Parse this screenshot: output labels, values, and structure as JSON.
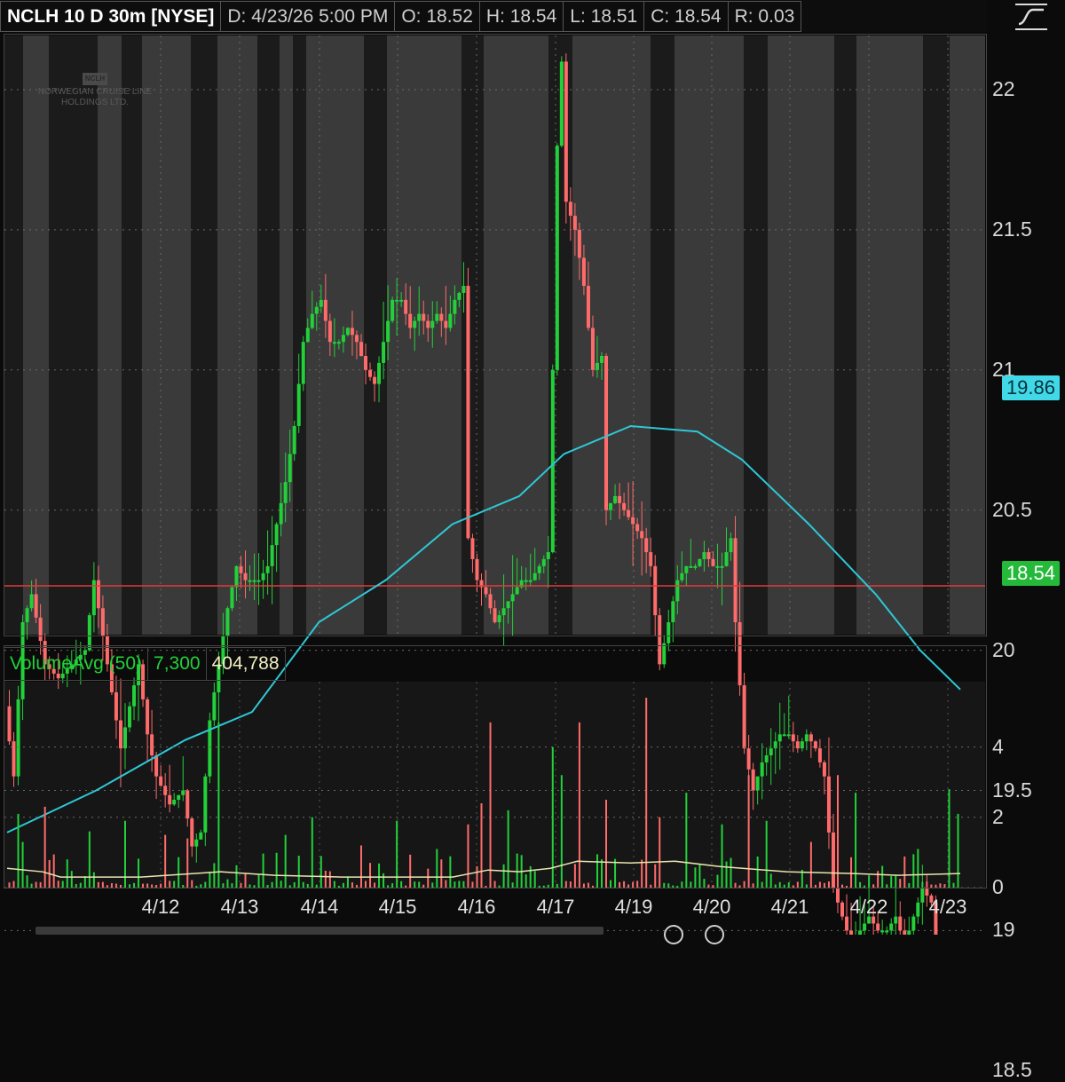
{
  "header": {
    "symbol": "NCLH 10 D 30m [NYSE]",
    "date": "D: 4/23/26 5:00 PM",
    "open": "O: 18.52",
    "high": "H: 18.54",
    "low": "L: 18.51",
    "close": "C: 18.54",
    "range": "R: 0.03"
  },
  "watermark": {
    "logo": "NCLH",
    "line1": "NORWEGIAN CRUISE LINE",
    "line2": "HOLDINGS LTD."
  },
  "badges": {
    "ma_value": "19.86",
    "last_price": "18.54"
  },
  "volume_legend": {
    "name": "VolumeAvg (50)",
    "volume": "7,300",
    "avg": "404,788"
  },
  "colors": {
    "up": "#22d13a",
    "down": "#ff6b6b",
    "ma": "#2ec8d6",
    "ref_line": "#e43a3a",
    "vol_avg": "#e8e6b0",
    "session_dark": "#1b1b1b",
    "session_light": "#3a3a3a"
  },
  "chart_data": [
    {
      "type": "candlestick",
      "interval": "30m",
      "period": "10 D",
      "ylim": [
        18.2,
        22.4
      ],
      "yticks": [
        "22",
        "21.5",
        "21",
        "20.5",
        "20",
        "19.5",
        "19",
        "18.5"
      ],
      "xticks": [
        "4/12",
        "4/13",
        "4/14",
        "4/15",
        "4/16",
        "4/17",
        "4/19",
        "4/20",
        "4/21",
        "4/22",
        "4/23"
      ],
      "reference_line": 20.23,
      "moving_average_last": 19.86,
      "last_price": 18.54,
      "price_path": [
        [
          0,
          19.8
        ],
        [
          2,
          19.55
        ],
        [
          4,
          20.1
        ],
        [
          6,
          20.2
        ],
        [
          9,
          19.95
        ],
        [
          12,
          19.9
        ],
        [
          15,
          19.95
        ],
        [
          18,
          20.0
        ],
        [
          20,
          20.25
        ],
        [
          23,
          19.95
        ],
        [
          26,
          19.65
        ],
        [
          28,
          19.8
        ],
        [
          30,
          19.95
        ],
        [
          32,
          19.7
        ],
        [
          34,
          19.55
        ],
        [
          37,
          19.45
        ],
        [
          40,
          19.5
        ],
        [
          42,
          19.3
        ],
        [
          44,
          19.35
        ],
        [
          46,
          19.75
        ],
        [
          48,
          19.95
        ],
        [
          50,
          20.15
        ],
        [
          52,
          20.3
        ],
        [
          54,
          20.25
        ],
        [
          57,
          20.25
        ],
        [
          59,
          20.3
        ],
        [
          61,
          20.45
        ],
        [
          63,
          20.6
        ],
        [
          65,
          20.8
        ],
        [
          67,
          21.1
        ],
        [
          69,
          21.2
        ],
        [
          71,
          21.25
        ],
        [
          73,
          21.1
        ],
        [
          75,
          21.1
        ],
        [
          77,
          21.15
        ],
        [
          79,
          21.1
        ],
        [
          81,
          21.0
        ],
        [
          83,
          20.95
        ],
        [
          85,
          21.1
        ],
        [
          87,
          21.25
        ],
        [
          89,
          21.25
        ],
        [
          91,
          21.15
        ],
        [
          93,
          21.2
        ],
        [
          95,
          21.15
        ],
        [
          97,
          21.2
        ],
        [
          99,
          21.15
        ],
        [
          101,
          21.25
        ],
        [
          103,
          21.3
        ],
        [
          104,
          20.4
        ],
        [
          106,
          20.25
        ],
        [
          108,
          20.2
        ],
        [
          110,
          20.1
        ],
        [
          112,
          20.15
        ],
        [
          114,
          20.2
        ],
        [
          116,
          20.25
        ],
        [
          118,
          20.25
        ],
        [
          120,
          20.3
        ],
        [
          122,
          20.35
        ],
        [
          123,
          21.0
        ],
        [
          124,
          21.8
        ],
        [
          125,
          22.1
        ],
        [
          126,
          21.6
        ],
        [
          128,
          21.5
        ],
        [
          130,
          21.3
        ],
        [
          132,
          21.0
        ],
        [
          134,
          21.05
        ],
        [
          135,
          20.5
        ],
        [
          137,
          20.55
        ],
        [
          139,
          20.5
        ],
        [
          141,
          20.45
        ],
        [
          143,
          20.4
        ],
        [
          145,
          20.3
        ],
        [
          147,
          19.95
        ],
        [
          149,
          20.1
        ],
        [
          151,
          20.25
        ],
        [
          153,
          20.3
        ],
        [
          155,
          20.3
        ],
        [
          157,
          20.35
        ],
        [
          159,
          20.3
        ],
        [
          161,
          20.3
        ],
        [
          163,
          20.4
        ],
        [
          164,
          20.1
        ],
        [
          166,
          19.65
        ],
        [
          168,
          19.5
        ],
        [
          170,
          19.6
        ],
        [
          172,
          19.65
        ],
        [
          174,
          19.7
        ],
        [
          176,
          19.7
        ],
        [
          178,
          19.65
        ],
        [
          180,
          19.7
        ],
        [
          182,
          19.65
        ],
        [
          184,
          19.55
        ],
        [
          186,
          19.15
        ],
        [
          188,
          19.05
        ],
        [
          190,
          18.95
        ],
        [
          192,
          19.0
        ],
        [
          194,
          19.05
        ],
        [
          196,
          19.0
        ],
        [
          198,
          19.0
        ],
        [
          200,
          19.05
        ],
        [
          202,
          18.95
        ],
        [
          204,
          19.05
        ],
        [
          206,
          19.15
        ],
        [
          208,
          19.1
        ],
        [
          209,
          18.65
        ],
        [
          211,
          18.45
        ],
        [
          213,
          18.5
        ],
        [
          214,
          18.54
        ]
      ],
      "moving_average_path": [
        [
          0,
          19.35
        ],
        [
          20,
          19.5
        ],
        [
          40,
          19.68
        ],
        [
          55,
          19.78
        ],
        [
          70,
          20.1
        ],
        [
          85,
          20.25
        ],
        [
          100,
          20.45
        ],
        [
          115,
          20.55
        ],
        [
          125,
          20.7
        ],
        [
          140,
          20.8
        ],
        [
          155,
          20.78
        ],
        [
          165,
          20.68
        ],
        [
          180,
          20.45
        ],
        [
          195,
          20.2
        ],
        [
          205,
          20.0
        ],
        [
          214,
          19.86
        ]
      ]
    },
    {
      "type": "bar",
      "title": "VolumeAvg (50)",
      "ylim": [
        0,
        5.8
      ],
      "yticks": [
        "4",
        "2",
        "0"
      ],
      "volume_spikes": [
        [
          2,
          2.1
        ],
        [
          3,
          1.3
        ],
        [
          8,
          2.3
        ],
        [
          18,
          1.6
        ],
        [
          26,
          1.9
        ],
        [
          35,
          1.5
        ],
        [
          40,
          1.4
        ],
        [
          47,
          4.7
        ],
        [
          62,
          1.5
        ],
        [
          68,
          2.0
        ],
        [
          79,
          1.2
        ],
        [
          87,
          1.9
        ],
        [
          96,
          1.1
        ],
        [
          103,
          1.8
        ],
        [
          106,
          2.4
        ],
        [
          108,
          4.7
        ],
        [
          112,
          2.2
        ],
        [
          122,
          4.0
        ],
        [
          124,
          3.2
        ],
        [
          128,
          4.7
        ],
        [
          134,
          2.5
        ],
        [
          143,
          5.4
        ],
        [
          146,
          2.0
        ],
        [
          152,
          2.7
        ],
        [
          160,
          1.8
        ],
        [
          166,
          3.2
        ],
        [
          170,
          1.9
        ],
        [
          180,
          1.3
        ],
        [
          186,
          3.2
        ],
        [
          190,
          2.7
        ],
        [
          204,
          1.1
        ],
        [
          211,
          2.8
        ],
        [
          213,
          2.1
        ]
      ],
      "avg_path": [
        [
          0,
          0.55
        ],
        [
          8,
          0.45
        ],
        [
          12,
          0.3
        ],
        [
          30,
          0.3
        ],
        [
          48,
          0.45
        ],
        [
          60,
          0.35
        ],
        [
          75,
          0.3
        ],
        [
          100,
          0.3
        ],
        [
          108,
          0.5
        ],
        [
          115,
          0.45
        ],
        [
          122,
          0.55
        ],
        [
          128,
          0.75
        ],
        [
          140,
          0.7
        ],
        [
          150,
          0.75
        ],
        [
          160,
          0.6
        ],
        [
          175,
          0.45
        ],
        [
          190,
          0.4
        ],
        [
          200,
          0.35
        ],
        [
          214,
          0.4
        ]
      ]
    }
  ]
}
